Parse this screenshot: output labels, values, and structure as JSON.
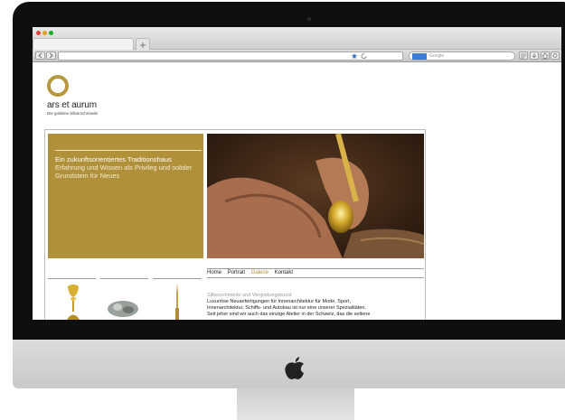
{
  "browser": {
    "search_placeholder": "Google"
  },
  "site": {
    "brand": "ars et aurum",
    "tagline": "Die goldene Silberschmiede",
    "hero_heading": "Ein zukunftsorientiertes Traditionshaus",
    "hero_text": "Erfahrung und Wissen als Privileg und solider Grundstein für Neues",
    "nav": [
      {
        "label": "Home"
      },
      {
        "label": "Portrait"
      },
      {
        "label": "Galerie",
        "active": true
      },
      {
        "label": "Kontakt"
      }
    ],
    "section_title": "Silberschmiede und Vergoldungskunst",
    "body_lines": [
      "Luxuriöse Neuanfertigungen für Innenarchitektur für Mode, Sport,",
      "Innenarchitektur, Schiffs- und Autobau ist nur eine unserer Spezialitäten.",
      "Seit jeher sind wir auch das einzige Atelier in der Schweiz, das die seltene"
    ]
  },
  "colors": {
    "gold": "#b09039",
    "logo_ring": "#b9973e",
    "nav_active": "#b09039"
  },
  "icons": [
    "apple-logo-icon",
    "camera-icon",
    "back-icon",
    "forward-icon",
    "search-icon",
    "reader-icon",
    "download-icon",
    "home-icon",
    "settings-icon"
  ]
}
